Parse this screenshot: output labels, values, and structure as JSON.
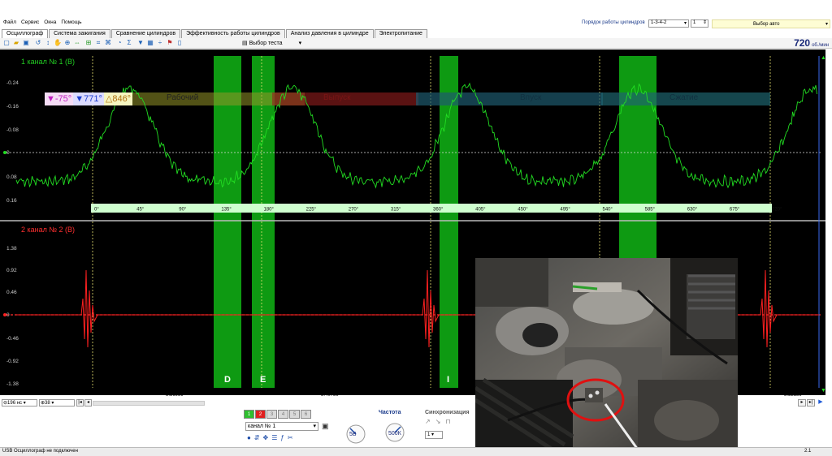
{
  "menu": [
    "Файл",
    "Сервис",
    "Окна",
    "Помощь"
  ],
  "firing_order_label": "Порядок работы цилиндров",
  "firing_order_value": "1-3-4-2",
  "cylinder_value": "1",
  "select_auto": "Выбор авто",
  "tabs": [
    "Осциллограф",
    "Система зажигания",
    "Сравнение цилиндров",
    "Эффективность работы цилиндров",
    "Анализ давления в цилиндре",
    "Электропитание"
  ],
  "select_test": "Выбор теста",
  "rpm": {
    "value": "720",
    "unit": "об./мин"
  },
  "channel1": {
    "label": "1  канал № 1 (В)",
    "color": "#22cc22",
    "yticks": [
      "-0.24",
      "-0.16",
      "-0.08",
      "0",
      "0.08",
      "0.16"
    ]
  },
  "channel2": {
    "label": "2  канал № 2 (В)",
    "color": "#ff2222",
    "yticks": [
      "1.38",
      "0.92",
      "0.46",
      "0",
      "-0.46",
      "-0.92",
      "-1.38"
    ]
  },
  "markers": {
    "m1": "-75°",
    "m2": "771°",
    "delta": "846°"
  },
  "phases": [
    "Рабочий",
    "Выпуск",
    "Впуск",
    "Сжатие"
  ],
  "degree_scale": [
    "0°",
    "45°",
    "90°",
    "135°",
    "180°",
    "225°",
    "270°",
    "315°",
    "360°",
    "405°",
    "450°",
    "495°",
    "540°",
    "585°",
    "630°",
    "675°",
    "720°"
  ],
  "zone_labels": [
    "D",
    "E",
    "I"
  ],
  "time_labels": [
    "8.36989",
    "8.40789",
    "8.52189"
  ],
  "timebase": "196 нс",
  "channel_count": "38",
  "channel_select": "канал № 1",
  "channel_buttons": [
    "1",
    "2",
    "3",
    "4",
    "5",
    "6"
  ],
  "freq_label": "Частота",
  "sync_label": "Синхронизация",
  "knob1": "5В",
  "knob2": "500К",
  "sync_value": "1",
  "status": "USB Осциллограф не подключен",
  "version": "2.1"
}
